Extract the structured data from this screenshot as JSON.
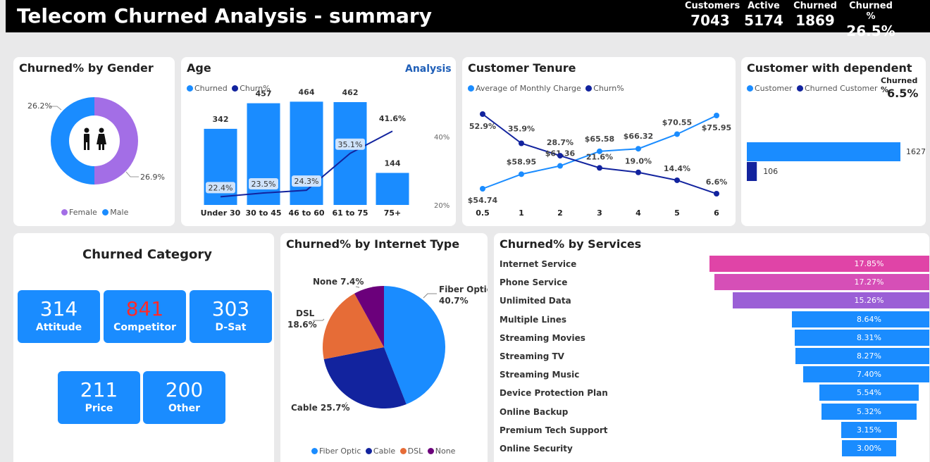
{
  "header": {
    "title": "Telecom Churned Analysis - summary",
    "kpis": [
      {
        "label": "Customers",
        "value": "7043"
      },
      {
        "label": "Active",
        "value": "5174"
      },
      {
        "label": "Churned",
        "value": "1869"
      },
      {
        "label": "Churned %",
        "value": "26.5%"
      }
    ]
  },
  "gender": {
    "title": "Churned% by Gender",
    "legend": [
      "Female",
      "Male"
    ],
    "colors": {
      "female": "#a36ee6",
      "male": "#1a8cff"
    },
    "chart_data": {
      "type": "pie",
      "categories": [
        "Female",
        "Male"
      ],
      "values": [
        26.9,
        26.2
      ],
      "data_labels": [
        "26.9%",
        "26.2%"
      ]
    }
  },
  "age": {
    "title": "Age",
    "link": "Analysis",
    "legend": [
      "Churned",
      "Churn%"
    ],
    "axis_ticks": [
      "40%",
      "20%"
    ],
    "chart_data": {
      "type": "bar",
      "categories": [
        "Under 30",
        "30 to 45",
        "46 to 60",
        "61 to 75",
        "75+"
      ],
      "series": [
        {
          "name": "Churned",
          "values": [
            342,
            457,
            464,
            462,
            144
          ]
        },
        {
          "name": "Churn%",
          "values": [
            22.4,
            23.5,
            24.3,
            35.1,
            41.6
          ]
        }
      ],
      "bar_labels": [
        "342",
        "457",
        "464",
        "462",
        "144"
      ],
      "line_labels": [
        "22.4%",
        "23.5%",
        "24.3%",
        "35.1%",
        "41.6%"
      ]
    }
  },
  "tenure": {
    "title": "Customer Tenure",
    "legend": [
      "Average of Monthly Charge",
      "Churn%"
    ],
    "chart_data": {
      "type": "line",
      "x": [
        "0.5",
        "1",
        "2",
        "3",
        "4",
        "5",
        "6"
      ],
      "series": [
        {
          "name": "Average of Monthly Charge",
          "values": [
            54.74,
            58.95,
            61.36,
            65.58,
            66.32,
            70.55,
            75.95
          ]
        },
        {
          "name": "Churn%",
          "values": [
            52.9,
            35.9,
            28.7,
            21.6,
            19.0,
            14.4,
            6.6
          ]
        }
      ],
      "charge_labels": [
        "$54.74",
        "$58.95",
        "$61.36",
        "$65.58",
        "$66.32",
        "$70.55",
        "$75.95"
      ],
      "churn_labels": [
        "52.9%",
        "35.9%",
        "28.7%",
        "21.6%",
        "19.0%",
        "14.4%",
        "6.6%"
      ]
    }
  },
  "dependent": {
    "title": "Customer with dependent",
    "legend": [
      "Customer",
      "Churned Customer"
    ],
    "churn_label": "Churned %",
    "churn_value": "6.5%",
    "chart_data": {
      "type": "bar",
      "categories": [
        "Customer",
        "Churned Customer"
      ],
      "values": [
        1627,
        106
      ],
      "data_labels": [
        "1627",
        "106"
      ]
    }
  },
  "category": {
    "title": "Churned Category",
    "tiles": [
      {
        "value": "314",
        "label": "Attitude"
      },
      {
        "value": "841",
        "label": "Competitor"
      },
      {
        "value": "303",
        "label": "D-Sat"
      },
      {
        "value": "211",
        "label": "Price"
      },
      {
        "value": "200",
        "label": "Other"
      }
    ]
  },
  "internet": {
    "title": "Churned% by Internet Type",
    "legend": [
      "Fiber Optic",
      "Cable",
      "DSL",
      "None"
    ],
    "colors": [
      "#1a8cff",
      "#12239e",
      "#e66c37",
      "#6b007b"
    ],
    "chart_data": {
      "type": "pie",
      "categories": [
        "Fiber Optic",
        "Cable",
        "DSL",
        "None"
      ],
      "values": [
        40.7,
        25.7,
        18.6,
        7.4
      ]
    },
    "labels": {
      "fiber_name": "Fiber Optic",
      "fiber_pct": "40.7%",
      "cable": "Cable 25.7%",
      "dsl_name": "DSL",
      "dsl_pct": "18.6%",
      "none": "None 7.4%"
    }
  },
  "services": {
    "title": "Churned% by Services",
    "chart_data": {
      "type": "bar",
      "categories": [
        "Internet Service",
        "Phone Service",
        "Unlimited Data",
        "Multiple Lines",
        "Streaming Movies",
        "Streaming TV",
        "Streaming Music",
        "Device Protection Plan",
        "Online Backup",
        "Premium Tech Support",
        "Online Security"
      ],
      "values": [
        17.85,
        17.27,
        15.26,
        8.64,
        8.31,
        8.27,
        7.4,
        5.54,
        5.32,
        3.15,
        3.0
      ]
    },
    "items": [
      {
        "label": "Internet Service",
        "value": "17.85%",
        "color": "#e044a7"
      },
      {
        "label": "Phone Service",
        "value": "17.27%",
        "color": "#d64fb7"
      },
      {
        "label": "Unlimited Data",
        "value": "15.26%",
        "color": "#9b5fd6"
      },
      {
        "label": "Multiple Lines",
        "value": "8.64%",
        "color": "#1a8cff"
      },
      {
        "label": "Streaming Movies",
        "value": "8.31%",
        "color": "#1a8cff"
      },
      {
        "label": "Streaming TV",
        "value": "8.27%",
        "color": "#1a8cff"
      },
      {
        "label": "Streaming Music",
        "value": "7.40%",
        "color": "#1a8cff"
      },
      {
        "label": "Device Protection Plan",
        "value": "5.54%",
        "color": "#1a8cff"
      },
      {
        "label": "Online Backup",
        "value": "5.32%",
        "color": "#1a8cff"
      },
      {
        "label": "Premium Tech Support",
        "value": "3.15%",
        "color": "#1a8cff"
      },
      {
        "label": "Online Security",
        "value": "3.00%",
        "color": "#1a8cff"
      }
    ]
  }
}
